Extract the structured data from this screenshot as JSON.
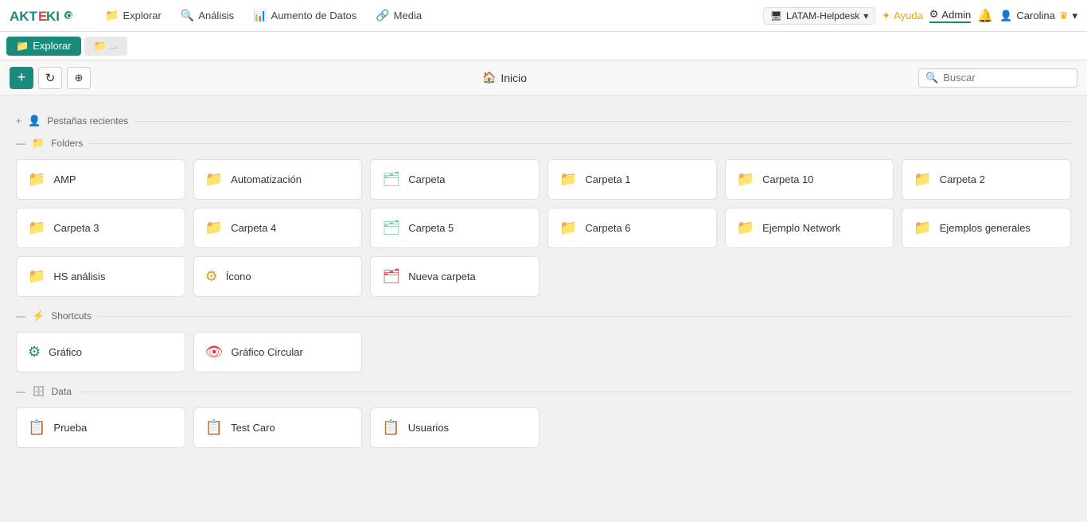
{
  "logo": {
    "text": "AKTEKIO"
  },
  "nav": {
    "items": [
      {
        "id": "explorar",
        "label": "Explorar",
        "icon": "📁"
      },
      {
        "id": "analisis",
        "label": "Análisis",
        "icon": "🔍"
      },
      {
        "id": "aumento-datos",
        "label": "Aumento de Datos",
        "icon": "📊"
      },
      {
        "id": "media",
        "label": "Media",
        "icon": "🔗"
      }
    ],
    "helpdesk": "LATAM-Helpdesk",
    "ayuda": "Ayuda",
    "admin": "Admin",
    "user": "Carolina"
  },
  "tabs": [
    {
      "id": "explorar-tab",
      "label": "Explorar",
      "active": true
    },
    {
      "id": "second-tab",
      "label": "",
      "active": false
    }
  ],
  "toolbar": {
    "add_label": "+",
    "refresh_label": "↻",
    "share_label": "⊕",
    "home_label": "Inicio",
    "search_placeholder": "Buscar"
  },
  "sections": {
    "recent": {
      "label": "Pestañas recientes",
      "toggle": "+",
      "icon": "👤"
    },
    "folders": {
      "label": "Folders",
      "toggle": "—",
      "icon": "📁",
      "items": [
        {
          "id": "amp",
          "label": "AMP",
          "icon": "folder",
          "color": "teal"
        },
        {
          "id": "automatizacion",
          "label": "Automatización",
          "icon": "folder",
          "color": "teal"
        },
        {
          "id": "carpeta",
          "label": "Carpeta",
          "icon": "folder-outline",
          "color": "outline"
        },
        {
          "id": "carpeta1",
          "label": "Carpeta 1",
          "icon": "folder",
          "color": "blue"
        },
        {
          "id": "carpeta10",
          "label": "Carpeta 10",
          "icon": "folder",
          "color": "green"
        },
        {
          "id": "carpeta2",
          "label": "Carpeta 2",
          "icon": "folder",
          "color": "teal"
        },
        {
          "id": "carpeta3",
          "label": "Carpeta 3",
          "icon": "folder",
          "color": "teal"
        },
        {
          "id": "carpeta4",
          "label": "Carpeta 4",
          "icon": "folder",
          "color": "teal"
        },
        {
          "id": "carpeta5",
          "label": "Carpeta 5",
          "icon": "folder-outline",
          "color": "outline"
        },
        {
          "id": "carpeta6",
          "label": "Carpeta 6",
          "icon": "folder",
          "color": "blue"
        },
        {
          "id": "ejemplo-network",
          "label": "Ejemplo Network",
          "icon": "folder",
          "color": "green"
        },
        {
          "id": "ejemplos-generales",
          "label": "Ejemplos generales",
          "icon": "folder",
          "color": "teal"
        },
        {
          "id": "hs-analisis",
          "label": "HS análisis",
          "icon": "folder",
          "color": "teal"
        },
        {
          "id": "icono",
          "label": "Ícono",
          "icon": "circle-icon",
          "color": "yellow"
        },
        {
          "id": "nueva-carpeta",
          "label": "Nueva carpeta",
          "icon": "folder-outline",
          "color": "red"
        }
      ]
    },
    "shortcuts": {
      "label": "Shortcuts",
      "toggle": "—",
      "icon": "⚡",
      "items": [
        {
          "id": "grafico",
          "label": "Gráfico",
          "icon": "gear",
          "color": "teal"
        },
        {
          "id": "grafico-circular",
          "label": "Gráfico Circular",
          "icon": "eye",
          "color": "red"
        }
      ]
    },
    "data": {
      "label": "Data",
      "toggle": "—",
      "icon": "🗄️",
      "items": [
        {
          "id": "prueba",
          "label": "Prueba",
          "icon": "table",
          "color": "yellow"
        },
        {
          "id": "test-caro",
          "label": "Test Caro",
          "icon": "table",
          "color": "yellow"
        },
        {
          "id": "usuarios",
          "label": "Usuarios",
          "icon": "table",
          "color": "yellow"
        }
      ]
    }
  }
}
